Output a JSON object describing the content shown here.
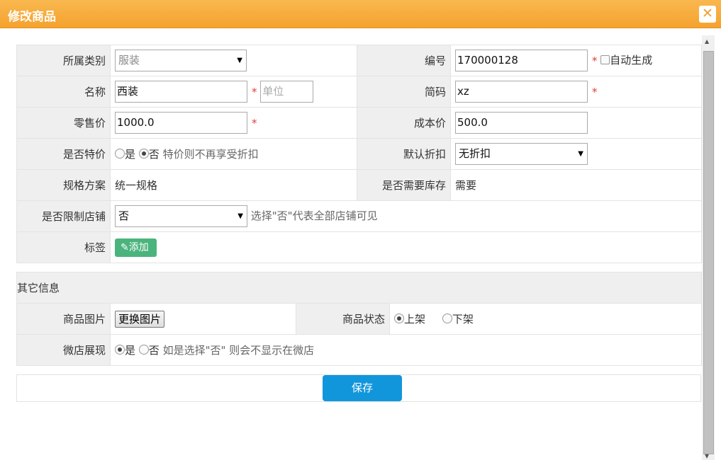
{
  "dialog": {
    "title": "修改商品",
    "close_symbol": "✕"
  },
  "form": {
    "category": {
      "label": "所属类别",
      "value": "服装"
    },
    "code": {
      "label": "编号",
      "value": "170000128",
      "auto_label": "自动生成"
    },
    "name": {
      "label": "名称",
      "value": "西装",
      "unit_placeholder": "单位"
    },
    "short_code": {
      "label": "简码",
      "value": "xz"
    },
    "retail_price": {
      "label": "零售价",
      "value": "1000.0"
    },
    "cost_price": {
      "label": "成本价",
      "value": "500.0"
    },
    "special": {
      "label": "是否特价",
      "yes": "是",
      "no": "否",
      "selected": "否",
      "hint": "特价则不再享受折扣"
    },
    "discount": {
      "label": "默认折扣",
      "value": "无折扣"
    },
    "spec": {
      "label": "规格方案",
      "value": "统一规格"
    },
    "stock": {
      "label": "是否需要库存",
      "value": "需要"
    },
    "restrict_store": {
      "label": "是否限制店铺",
      "value": "否",
      "hint": "选择\"否\"代表全部店铺可见"
    },
    "tags": {
      "label": "标签",
      "add_label": "添加"
    }
  },
  "other": {
    "section_title": "其它信息",
    "image": {
      "label": "商品图片",
      "button_label": "更换图片"
    },
    "status": {
      "label": "商品状态",
      "on": "上架",
      "off": "下架",
      "selected": "上架"
    },
    "wechat": {
      "label": "微店展现",
      "yes": "是",
      "no": "否",
      "selected": "是",
      "hint": "如是选择\"否\" 则会不显示在微店"
    }
  },
  "actions": {
    "save_label": "保存"
  },
  "required_mark": "*",
  "colors": {
    "title_bar": "#f5a22e",
    "save_button": "#1296db",
    "tag_button": "#4ab47c",
    "required": "#e03c3c"
  }
}
